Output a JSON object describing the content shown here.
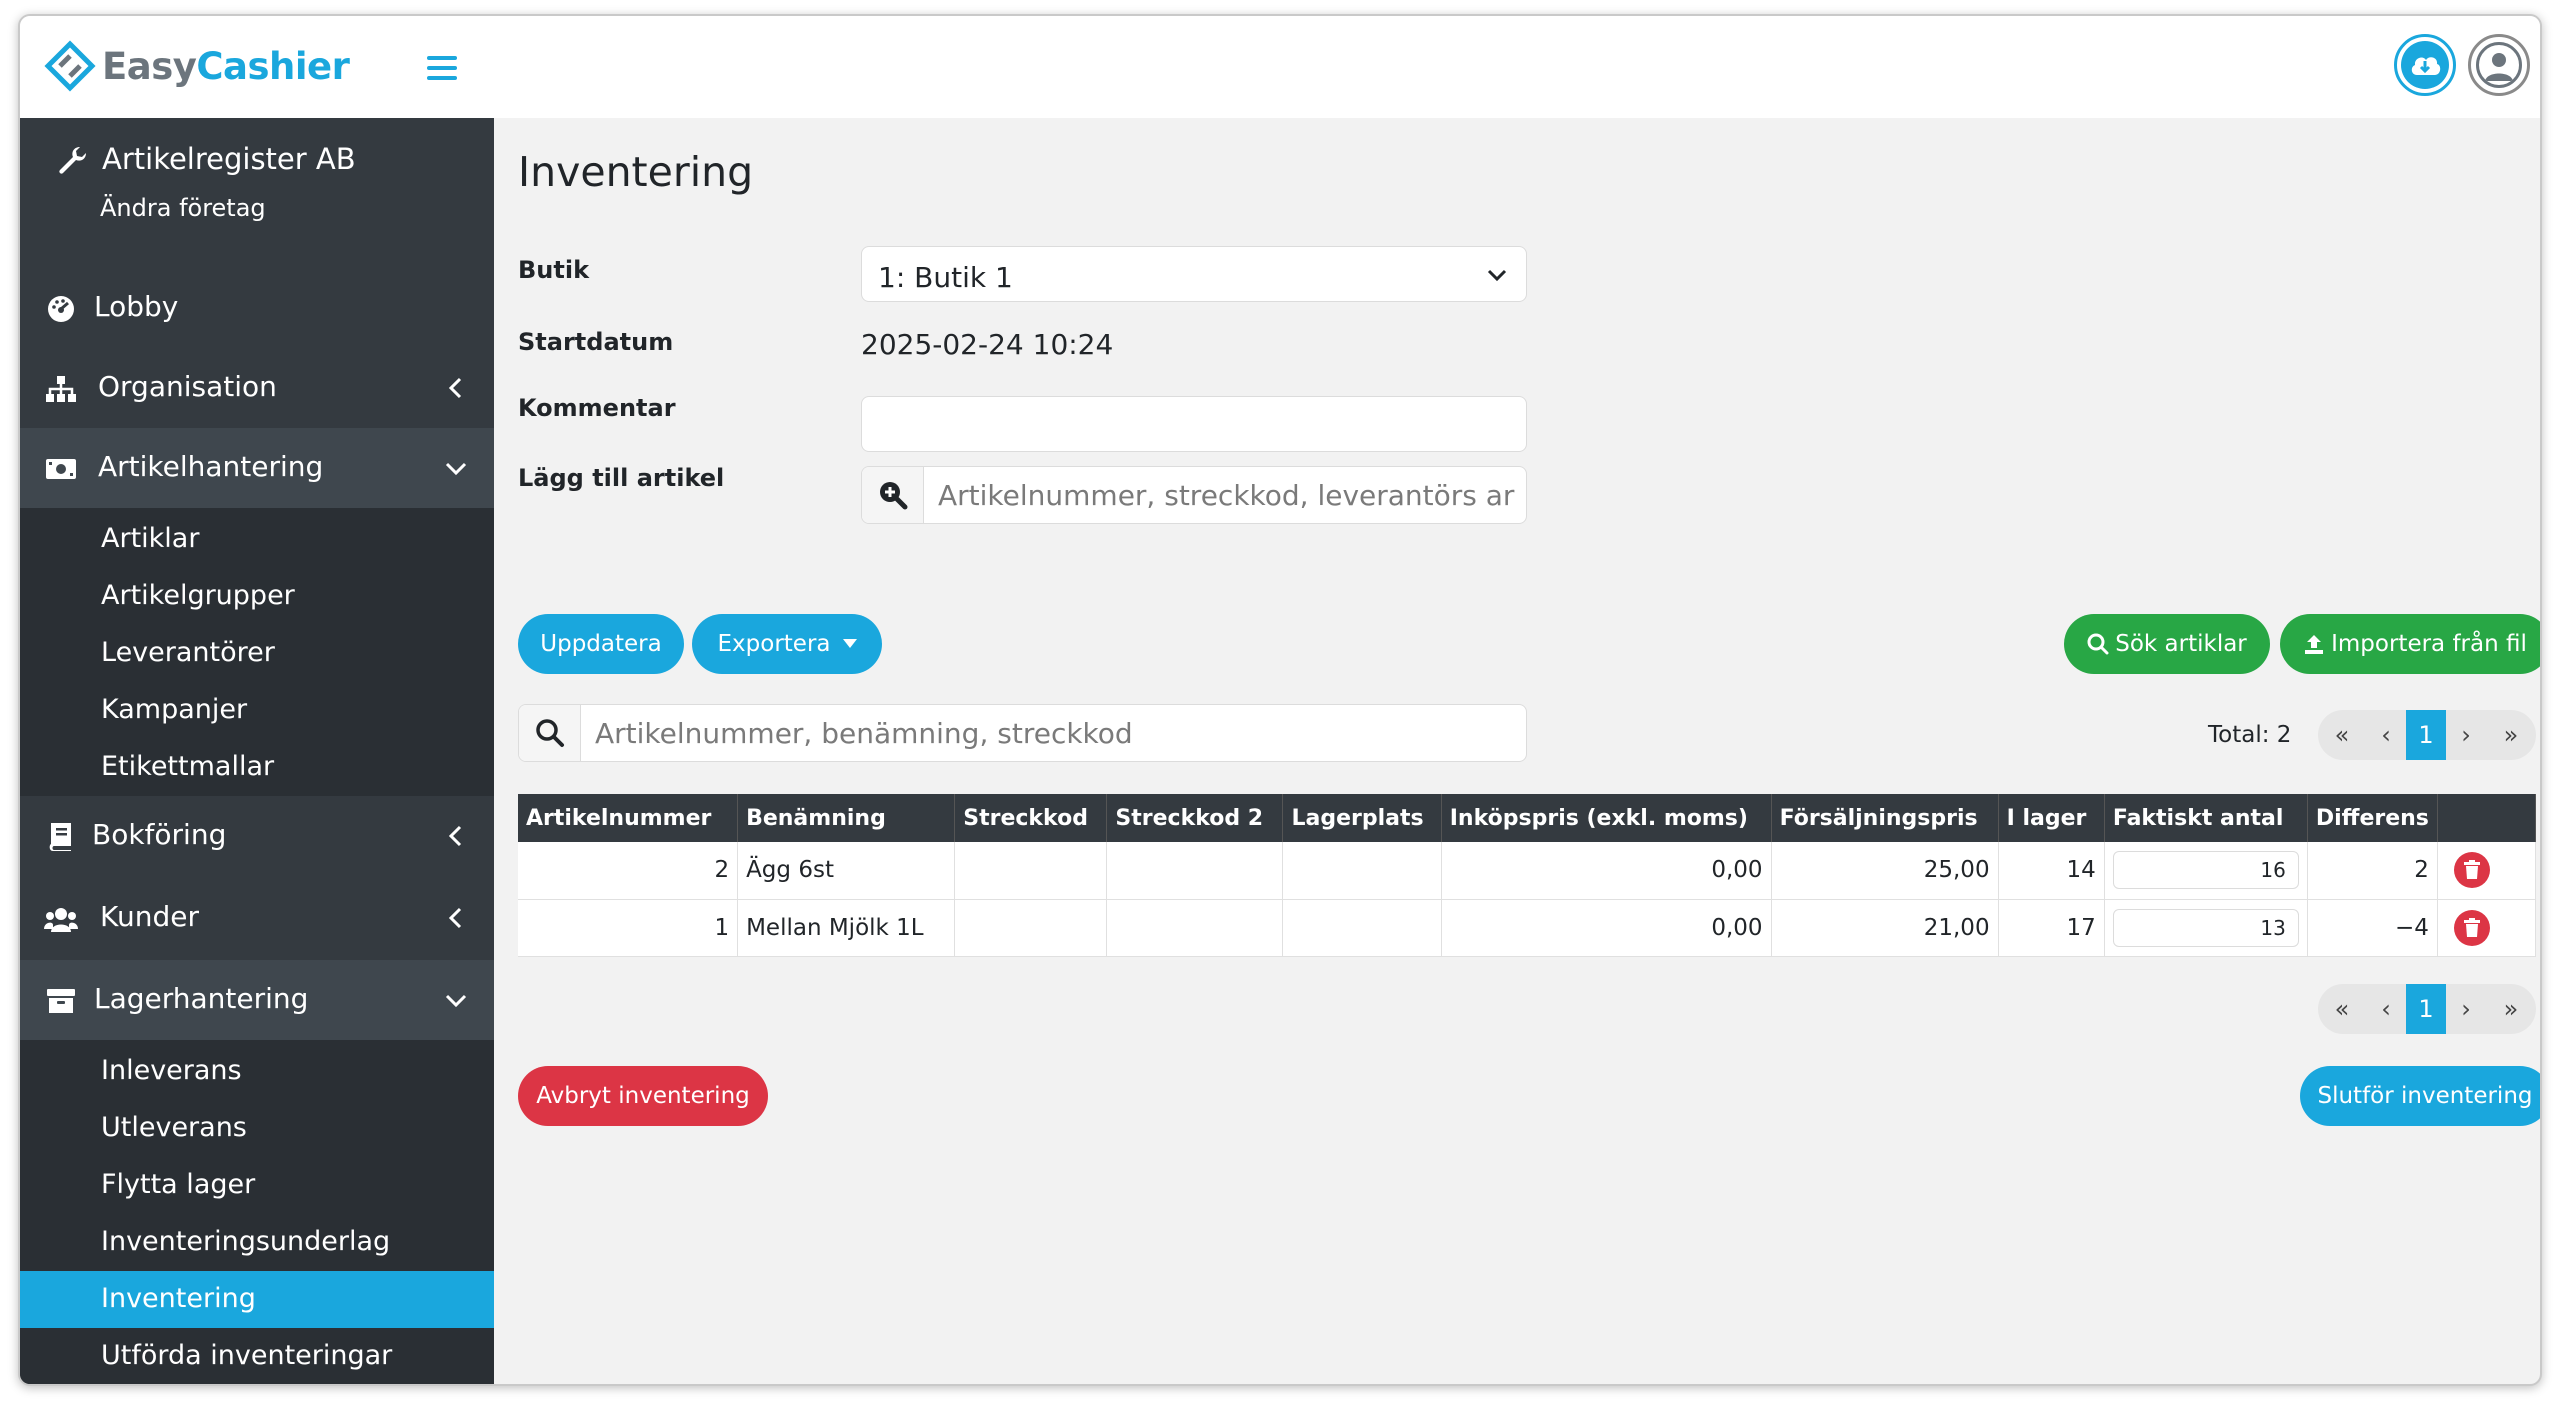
{
  "header": {
    "logo_easy": "Easy",
    "logo_cashier": "Cashier",
    "menu_icon": "hamburger-icon",
    "cloud_icon": "cloud-download-icon",
    "user_icon": "user-circle-icon"
  },
  "sidebar": {
    "company_name": "Artikelregister AB",
    "company_sub": "Ändra företag",
    "items": [
      {
        "label": "Lobby",
        "icon": "dashboard-icon"
      },
      {
        "label": "Organisation",
        "icon": "sitemap-icon"
      },
      {
        "label": "Artikelhantering",
        "icon": "money-bill-icon"
      },
      {
        "label": "Bokföring",
        "icon": "book-icon"
      },
      {
        "label": "Kunder",
        "icon": "users-icon"
      },
      {
        "label": "Lagerhantering",
        "icon": "archive-icon"
      }
    ],
    "artikel_sub": [
      "Artiklar",
      "Artikelgrupper",
      "Leverantörer",
      "Kampanjer",
      "Etikettmallar"
    ],
    "lager_sub": [
      "Inleverans",
      "Utleverans",
      "Flytta lager",
      "Inventeringsunderlag",
      "Inventering",
      "Utförda inventeringar"
    ]
  },
  "page": {
    "title": "Inventering",
    "labels": {
      "butik": "Butik",
      "startdatum": "Startdatum",
      "kommentar": "Kommentar",
      "lagg_till": "Lägg till artikel"
    },
    "butik_value": "1: Butik 1",
    "startdatum_value": "2025-02-24 10:24",
    "kommentar_value": "",
    "add_placeholder": "Artikelnummer, streckkod, leverantörs ar",
    "buttons": {
      "uppdatera": "Uppdatera",
      "exportera": "Exportera",
      "sok_artiklar": "Sök artiklar",
      "importera": "Importera från fil",
      "avbryt": "Avbryt inventering",
      "slutfor": "Slutför inventering"
    },
    "search_placeholder": "Artikelnummer, benämning, streckkod",
    "total": "Total: 2",
    "current_page": "1"
  },
  "table": {
    "columns": [
      "Artikelnummer",
      "Benämning",
      "Streckkod",
      "Streckkod 2",
      "Lagerplats",
      "Inköpspris (exkl. moms)",
      "Försäljningspris",
      "I lager",
      "Faktiskt antal",
      "Differens",
      ""
    ],
    "rows": [
      {
        "artikelnummer": "2",
        "benamning": "Ägg 6st",
        "streckkod": "",
        "streckkod2": "",
        "lagerplats": "",
        "inkopspris": "0,00",
        "forsaljningspris": "25,00",
        "i_lager": "14",
        "faktiskt_antal": "16",
        "differens": "2"
      },
      {
        "artikelnummer": "1",
        "benamning": "Mellan Mjölk 1L",
        "streckkod": "",
        "streckkod2": "",
        "lagerplats": "",
        "inkopspris": "0,00",
        "forsaljningspris": "21,00",
        "i_lager": "17",
        "faktiskt_antal": "13",
        "differens": "−4"
      }
    ]
  },
  "colors": {
    "accent": "#1aa7dd",
    "sidebar": "#343a40",
    "success": "#28a745",
    "danger": "#dc3545"
  }
}
